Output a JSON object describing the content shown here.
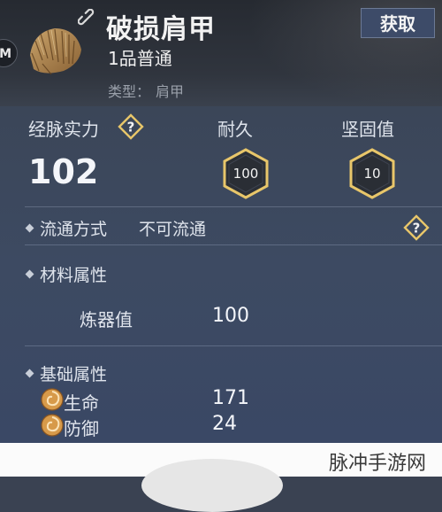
{
  "header": {
    "badge": "M",
    "title": "破损肩甲",
    "quality": "1品普通",
    "type_label": "类型：",
    "type_value": "肩甲",
    "get_button": "获取"
  },
  "stats": {
    "power_label": "经脉实力",
    "power_value": "102",
    "durability_label": "耐久",
    "durability_value": "100",
    "firmness_label": "坚固值",
    "firmness_value": "10"
  },
  "circulation": {
    "label": "流通方式",
    "value": "不可流通"
  },
  "material": {
    "title": "材料属性",
    "refine_label": "炼器值",
    "refine_value": "100"
  },
  "base": {
    "title": "基础属性",
    "items": [
      {
        "label": "生命",
        "value": "171"
      },
      {
        "label": "防御",
        "value": "24"
      }
    ]
  },
  "watermark": "脉冲手游网",
  "colors": {
    "hex_gold": "#e8c66a",
    "accent_button": "#3d4b68"
  },
  "icons": [
    "item-shoulder-armor-icon",
    "link-icon",
    "help-icon",
    "attribute-swirl-icon"
  ]
}
